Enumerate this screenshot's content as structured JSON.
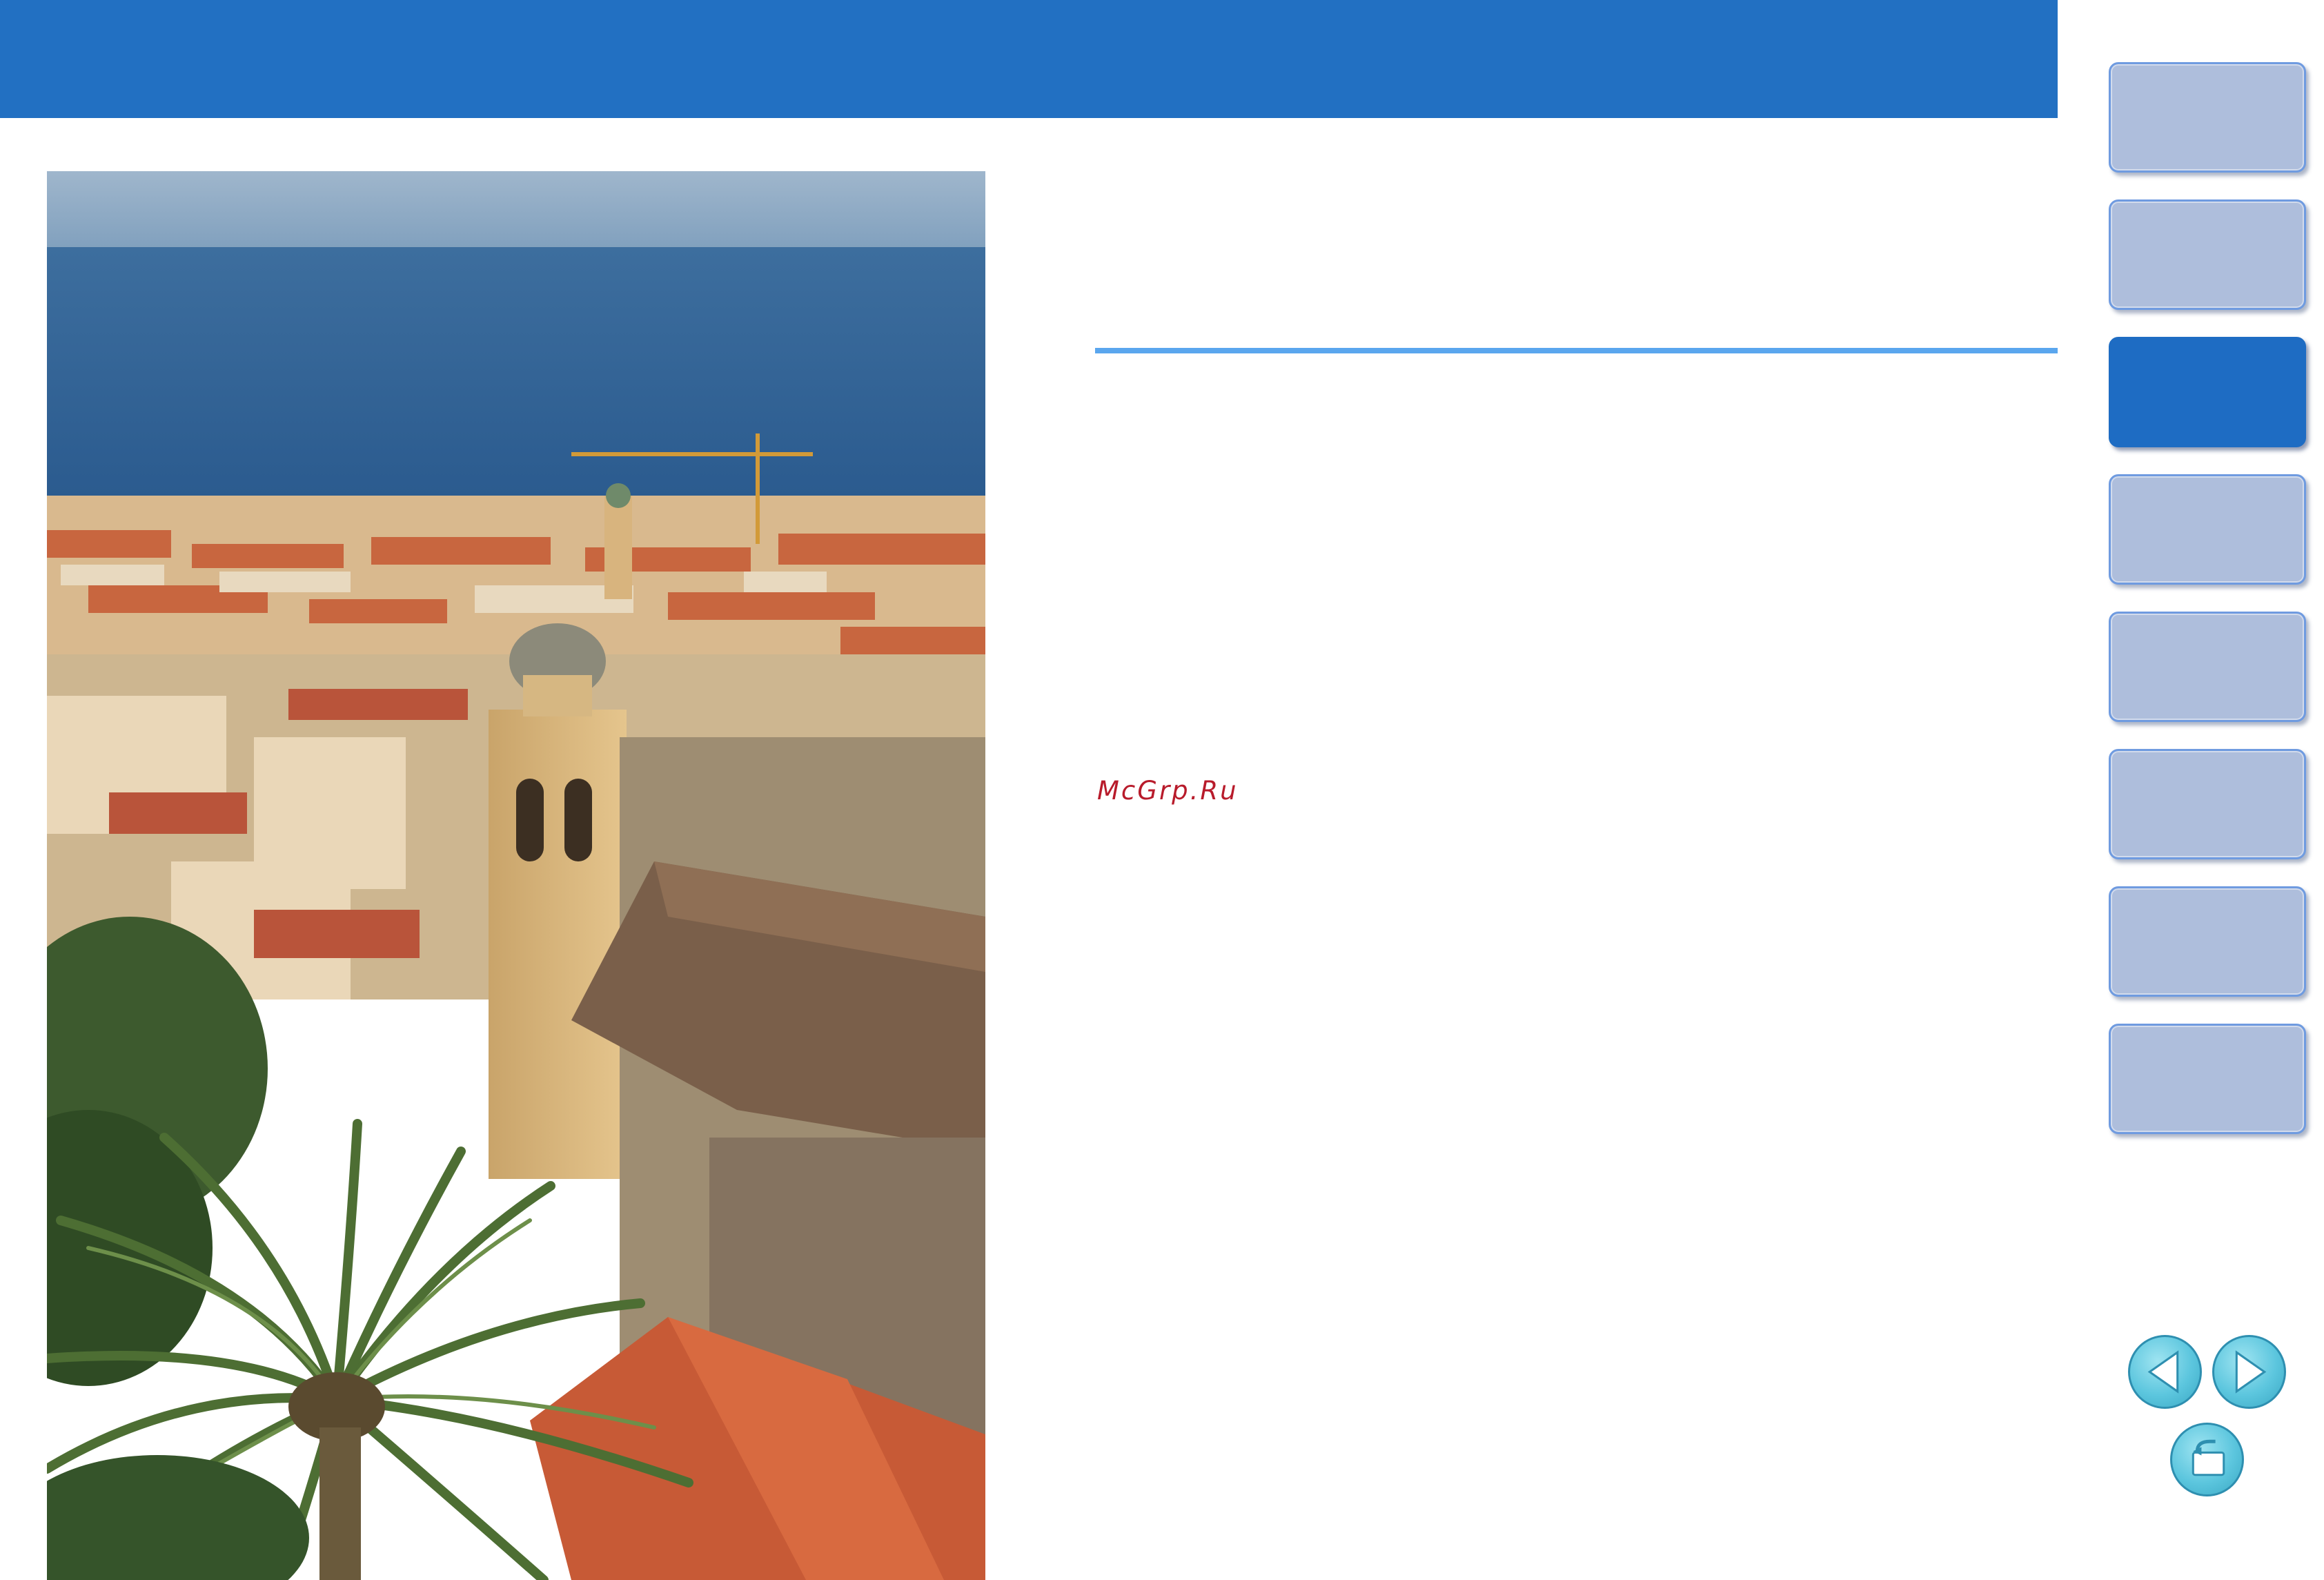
{
  "watermark": "McGrp.Ru",
  "colors": {
    "header": "#2270c2",
    "divider": "#5aa6ee",
    "tab_inactive": "#aebedc",
    "tab_active": "#1e6cc3",
    "nav_button": "#5cc6de"
  },
  "side_tabs": [
    {
      "id": "tab-1",
      "active": false
    },
    {
      "id": "tab-2",
      "active": false
    },
    {
      "id": "tab-3",
      "active": true
    },
    {
      "id": "tab-4",
      "active": false
    },
    {
      "id": "tab-5",
      "active": false
    },
    {
      "id": "tab-6",
      "active": false
    },
    {
      "id": "tab-7",
      "active": false
    },
    {
      "id": "tab-8",
      "active": false
    }
  ],
  "nav_buttons": {
    "previous": "triangle-left-icon",
    "next": "triangle-right-icon",
    "return": "return-arrow-icon"
  }
}
